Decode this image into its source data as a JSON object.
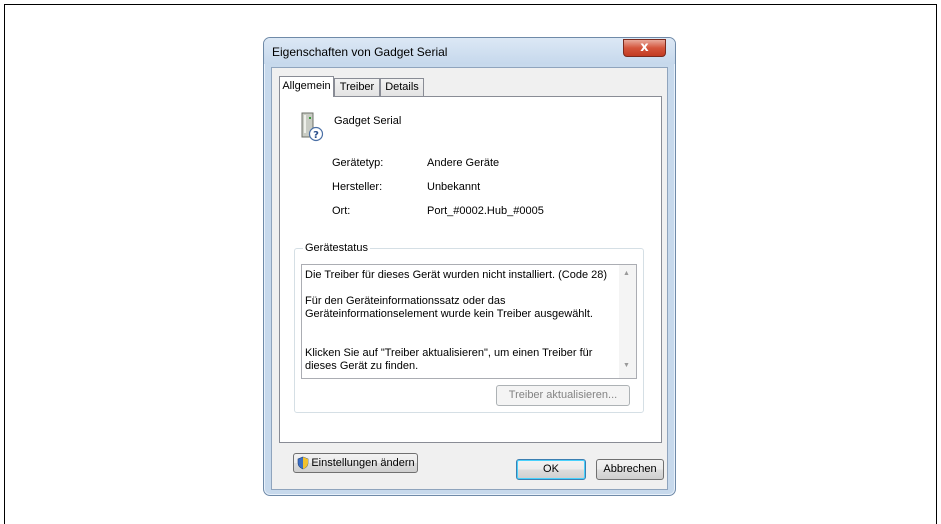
{
  "window": {
    "title": "Eigenschaften von Gadget Serial",
    "close_symbol": "x"
  },
  "tabs": [
    {
      "label": "Allgemein",
      "active": true
    },
    {
      "label": "Treiber",
      "active": false
    },
    {
      "label": "Details",
      "active": false
    }
  ],
  "device": {
    "name": "Gadget Serial",
    "icon": "unknown-device-icon",
    "properties": [
      {
        "label": "Gerätetyp:",
        "value": "Andere Geräte"
      },
      {
        "label": "Hersteller:",
        "value": "Unbekannt"
      },
      {
        "label": "Ort:",
        "value": "Port_#0002.Hub_#0005"
      }
    ]
  },
  "status": {
    "group_label": "Gerätestatus",
    "lines": [
      "Die Treiber für dieses Gerät wurden nicht installiert. (Code 28)",
      "Für den Geräteinformationssatz oder das Geräteinformationselement wurde kein Treiber ausgewählt.",
      "Klicken Sie auf \"Treiber aktualisieren\", um einen Treiber für dieses Gerät zu finden."
    ],
    "update_button": "Treiber aktualisieren..."
  },
  "settings_button": "Einstellungen ändern",
  "footer": {
    "ok": "OK",
    "cancel": "Abbrechen"
  },
  "colors": {
    "accent_border": "#3c7fb1",
    "close_red": "#c23b22"
  }
}
